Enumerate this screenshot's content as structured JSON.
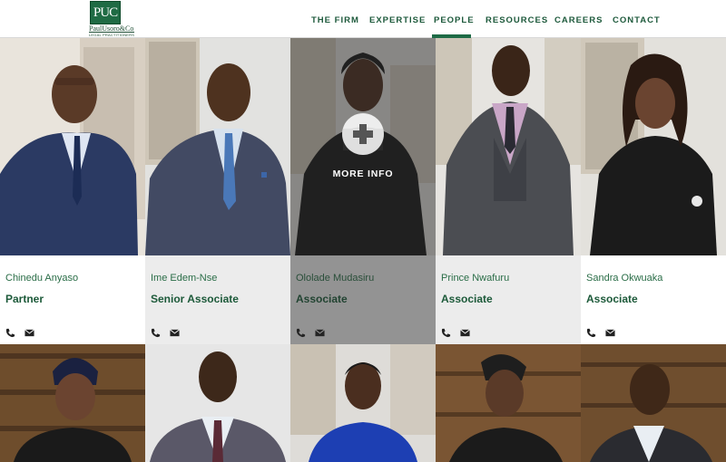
{
  "brand": {
    "monogram": "PUC",
    "name": "PaulUsoro&Co",
    "tagline": "LEGAL PRACTITIONERS"
  },
  "nav": {
    "items": [
      "THE FIRM",
      "EXPERTISE",
      "PEOPLE",
      "RESOURCES",
      "CAREERS",
      "CONTACT"
    ],
    "active": "PEOPLE"
  },
  "people": [
    {
      "name": "Chinedu Anyaso",
      "role": "Partner"
    },
    {
      "name": "Ime Edem-Nse",
      "role": "Senior Associate"
    },
    {
      "name": "Ololade Mudasiru",
      "role": "Associate"
    },
    {
      "name": "Prince Nwafuru",
      "role": "Associate"
    },
    {
      "name": "Sandra Okwuaka",
      "role": "Associate"
    }
  ],
  "overlay": {
    "label": "MORE INFO"
  },
  "colors": {
    "brand_green": "#1e5a3c",
    "accent_green": "#1e6b46",
    "alt_card_bg": "#ececec",
    "hover_card_bg": "#8a8a8a"
  }
}
